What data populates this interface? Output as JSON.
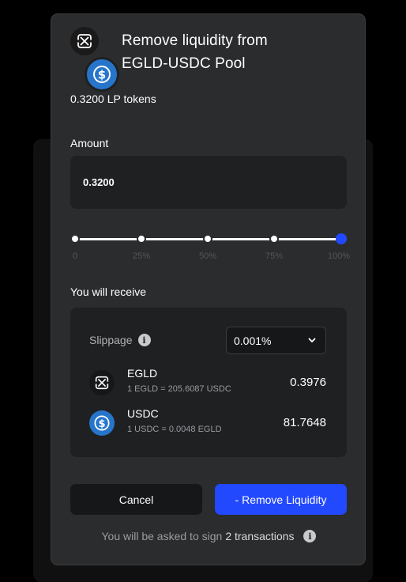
{
  "modal": {
    "title_line_1": "Remove liquidity from",
    "title_line_2": "EGLD-USDC Pool",
    "lp_tokens": "0.3200 LP tokens"
  },
  "amount": {
    "label": "Amount",
    "value": "0.3200"
  },
  "slider": {
    "ticks": [
      "0",
      "25%",
      "50%",
      "75%",
      "100%"
    ],
    "selected_percent": 100
  },
  "receive": {
    "label": "You will receive",
    "slippage_label": "Slippage",
    "slippage_value": "0.001%",
    "tokens": [
      {
        "symbol": "EGLD",
        "rate": "1 EGLD = 205.6087 USDC",
        "amount": "0.3976",
        "icon": "egld-icon"
      },
      {
        "symbol": "USDC",
        "rate": "1 USDC = 0.0048 EGLD",
        "amount": "81.7648",
        "icon": "usdc-icon"
      }
    ]
  },
  "actions": {
    "cancel_label": "Cancel",
    "remove_label": "- Remove Liquidity"
  },
  "sign_note": {
    "prefix": "You will be asked to sign",
    "count_text": "2 transactions"
  },
  "colors": {
    "accent": "#2349ff",
    "modal_bg": "#2b2c2e",
    "panel_bg": "#1f2022",
    "usdc": "#2775ca"
  }
}
